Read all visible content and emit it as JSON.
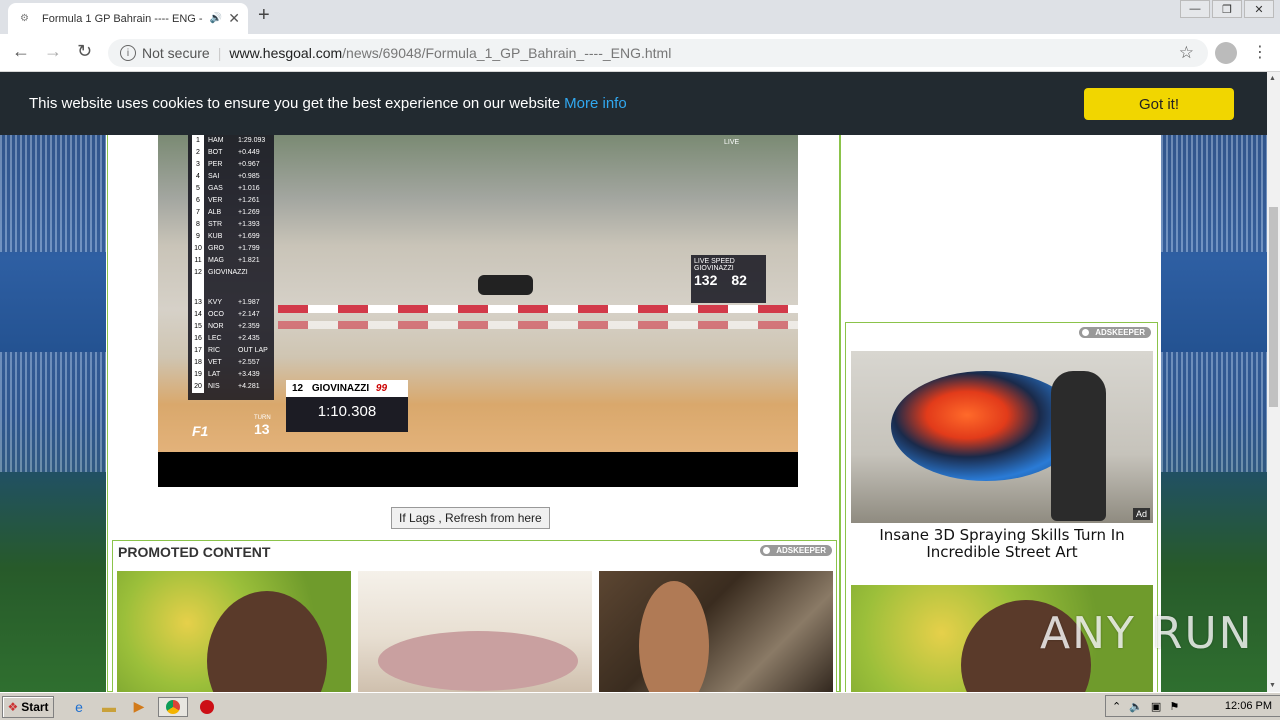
{
  "browser": {
    "tab_title": "Formula 1 GP Bahrain ---- ENG -",
    "new_tab": "+",
    "back": "←",
    "forward": "→",
    "reload": "↻",
    "not_secure": "Not secure",
    "url_domain": "www.hesgoal.com",
    "url_path": "/news/69048/Formula_1_GP_Bahrain_----_ENG.html"
  },
  "cookie_banner": {
    "text": "This website uses cookies to ensure you get the best experience on our website",
    "more_info": "More info",
    "button": "Got it!"
  },
  "video": {
    "live": "LIVE",
    "leaderboard": [
      {
        "pos": "1",
        "driver": "HAM",
        "gap": "1:29.093"
      },
      {
        "pos": "2",
        "driver": "BOT",
        "gap": "+0.449"
      },
      {
        "pos": "3",
        "driver": "PER",
        "gap": "+0.967"
      },
      {
        "pos": "4",
        "driver": "SAI",
        "gap": "+0.985"
      },
      {
        "pos": "5",
        "driver": "GAS",
        "gap": "+1.016"
      },
      {
        "pos": "6",
        "driver": "VER",
        "gap": "+1.261"
      },
      {
        "pos": "7",
        "driver": "ALB",
        "gap": "+1.269"
      },
      {
        "pos": "8",
        "driver": "STR",
        "gap": "+1.393"
      },
      {
        "pos": "9",
        "driver": "KUB",
        "gap": "+1.699"
      },
      {
        "pos": "10",
        "driver": "GRO",
        "gap": "+1.799"
      },
      {
        "pos": "11",
        "driver": "MAG",
        "gap": "+1.821"
      },
      {
        "pos": "12",
        "driver": "GIOVINAZZI",
        "gap": ""
      },
      {
        "pos": "13",
        "driver": "KVY",
        "gap": "+1.987"
      },
      {
        "pos": "14",
        "driver": "OCO",
        "gap": "+2.147"
      },
      {
        "pos": "15",
        "driver": "NOR",
        "gap": "+2.359"
      },
      {
        "pos": "16",
        "driver": "LEC",
        "gap": "+2.435"
      },
      {
        "pos": "17",
        "driver": "RIC",
        "gap": "OUT LAP"
      },
      {
        "pos": "18",
        "driver": "VET",
        "gap": "+2.557"
      },
      {
        "pos": "19",
        "driver": "LAT",
        "gap": "+3.439"
      },
      {
        "pos": "20",
        "driver": "NIS",
        "gap": "+4.281"
      }
    ],
    "live_speed_label": "LIVE SPEED",
    "live_speed_driver": "GIOVINAZZI",
    "speed_kmh": "132",
    "speed_mph": "82",
    "timer_driver_num": "12",
    "timer_driver": "GIOVINAZZI",
    "timer_car_num": "99",
    "lap_time": "1:10.308",
    "turn_label": "TURN",
    "turn_num": "13",
    "f1_logo": "F1"
  },
  "refresh_button": "If Lags , Refresh from here",
  "promoted": {
    "heading": "PROMOTED CONTENT",
    "adskeeper": "ADSKEEPER"
  },
  "side_ad": {
    "adskeeper": "ADSKEEPER",
    "ad_tag": "Ad",
    "title": "Insane 3D Spraying Skills Turn In Incredible Street Art"
  },
  "watermark": "ANY RUN",
  "taskbar": {
    "start": "Start",
    "clock": "12:06 PM"
  },
  "colors": {
    "cookie_bg": "#222a30",
    "cookie_link": "#31a8f0",
    "got_it": "#f1d600",
    "border_green": "#8bc34a"
  }
}
